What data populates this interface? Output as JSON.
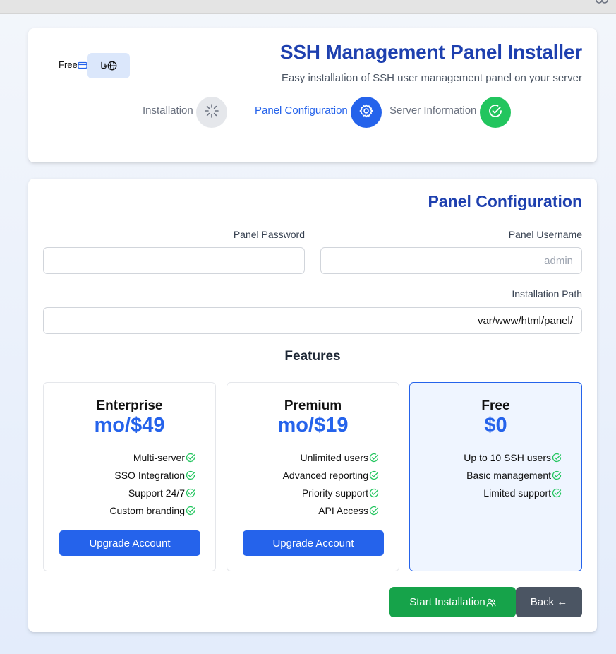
{
  "header": {
    "title": "SSH Management Panel Installer",
    "subtitle": "Easy installation of SSH user management panel on your server",
    "plan_switch_label": "Free",
    "language_label": "فا"
  },
  "steps": [
    {
      "label": "Installation",
      "icon": "spinner-icon",
      "state": "pending",
      "color": "#e5e7eb"
    },
    {
      "label": "Panel Configuration",
      "icon": "gear-icon",
      "state": "active",
      "color": "#2563eb"
    },
    {
      "label": "Server Information",
      "icon": "check-circle-icon",
      "state": "done",
      "color": "#22c55e"
    }
  ],
  "form": {
    "section_title": "Panel Configuration",
    "password_label": "Panel Password",
    "password_value": "",
    "username_label": "Panel Username",
    "username_placeholder": "admin",
    "path_label": "Installation Path",
    "path_value": "var/www/html/panel/"
  },
  "features": {
    "title": "Features",
    "plans": [
      {
        "name": "Enterprise",
        "price": "mo/$49",
        "features": [
          "Multi-server",
          "SSO Integration",
          "Support 24/7",
          "Custom branding"
        ],
        "button": "Upgrade Account"
      },
      {
        "name": "Premium",
        "price": "mo/$19",
        "features": [
          "Unlimited users",
          "Advanced reporting",
          "Priority support",
          "API Access"
        ],
        "button": "Upgrade Account"
      },
      {
        "name": "Free",
        "price": "$0",
        "features": [
          "Up to 10 SSH users",
          "Basic management",
          "Limited support"
        ],
        "current": true
      }
    ]
  },
  "actions": {
    "start_label": "Start Installation",
    "back_label": "Back ←"
  },
  "colors": {
    "primary": "#2563eb",
    "title": "#1e40af",
    "success": "#16a34a",
    "secondary": "#4b5563"
  }
}
